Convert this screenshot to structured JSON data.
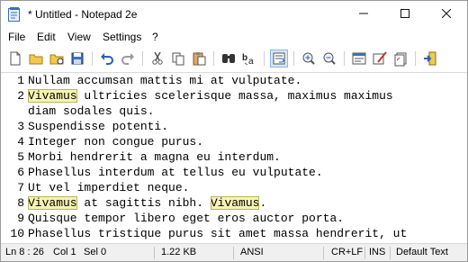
{
  "window": {
    "title": "* Untitled - Notepad 2e",
    "controls": {
      "minimize_icon": "minimize-icon",
      "maximize_icon": "maximize-icon",
      "close_icon": "close-icon"
    }
  },
  "menu": {
    "items": [
      "File",
      "Edit",
      "View",
      "Settings",
      "?"
    ]
  },
  "toolbar": {
    "buttons": [
      {
        "name": "new-icon"
      },
      {
        "name": "open-icon"
      },
      {
        "name": "browse-icon"
      },
      {
        "name": "save-icon"
      },
      {
        "name": "undo-icon"
      },
      {
        "name": "redo-icon"
      },
      {
        "name": "cut-icon"
      },
      {
        "name": "copy-icon"
      },
      {
        "name": "paste-icon"
      },
      {
        "name": "find-icon"
      },
      {
        "name": "replace-icon"
      },
      {
        "name": "word-wrap-icon",
        "active": true
      },
      {
        "name": "zoom-in-icon"
      },
      {
        "name": "zoom-out-icon"
      },
      {
        "name": "scheme-icon"
      },
      {
        "name": "customize-schemes-icon"
      },
      {
        "name": "new-window-icon"
      },
      {
        "name": "exit-icon"
      }
    ]
  },
  "editor": {
    "highlight_color": "#f6f3b4",
    "lines": [
      {
        "num": "1",
        "parts": [
          {
            "t": "Nullam accumsan mattis mi at vulputate."
          }
        ]
      },
      {
        "num": "2",
        "parts": [
          {
            "t": "Vivamus",
            "hl": true
          },
          {
            "t": " ultricies scelerisque massa, maximus maximus"
          }
        ]
      },
      {
        "num": "",
        "parts": [
          {
            "t": "diam sodales quis."
          }
        ]
      },
      {
        "num": "3",
        "parts": [
          {
            "t": "Suspendisse potenti."
          }
        ]
      },
      {
        "num": "4",
        "parts": [
          {
            "t": "Integer non congue purus."
          }
        ]
      },
      {
        "num": "5",
        "parts": [
          {
            "t": "Morbi hendrerit a magna eu interdum."
          }
        ]
      },
      {
        "num": "6",
        "parts": [
          {
            "t": "Phasellus interdum at tellus eu vulputate."
          }
        ]
      },
      {
        "num": "7",
        "parts": [
          {
            "t": "Ut vel imperdiet neque."
          }
        ]
      },
      {
        "num": "8",
        "parts": [
          {
            "t": "Vivamus",
            "hl": true
          },
          {
            "t": " at sagittis nibh. "
          },
          {
            "t": "Vivamus",
            "hl": true
          },
          {
            "t": "."
          }
        ]
      },
      {
        "num": "9",
        "parts": [
          {
            "t": "Quisque tempor libero eget eros auctor porta."
          }
        ]
      },
      {
        "num": "10",
        "parts": [
          {
            "t": "Phasellus tristique purus sit amet massa hendrerit, ut"
          }
        ]
      }
    ]
  },
  "status": {
    "position": "Ln 8 : 26",
    "column": "Col 1",
    "selection": "Sel 0",
    "size": "1.22 KB",
    "encoding": "ANSI",
    "line_endings": "CR+LF",
    "insert_mode": "INS",
    "scheme": "Default Text"
  }
}
